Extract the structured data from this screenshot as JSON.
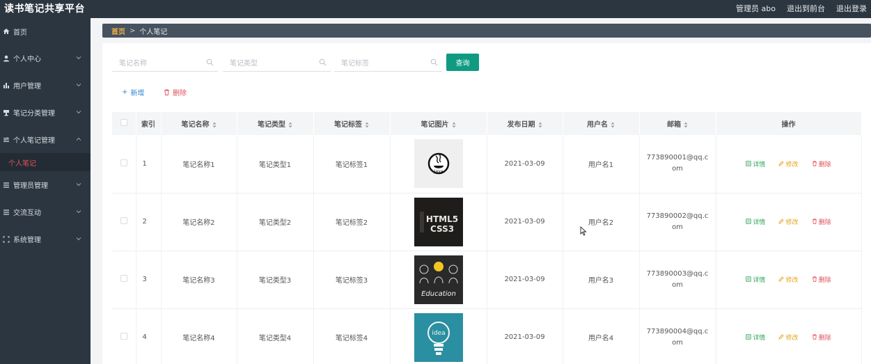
{
  "app": {
    "title": "读书笔记共享平台",
    "admin": "管理员 abo",
    "to_front": "退出到前台",
    "logout": "退出登录"
  },
  "sidebar": {
    "items": [
      {
        "label": "首页",
        "icon": "home-icon",
        "has_chevron": false
      },
      {
        "label": "个人中心",
        "icon": "user-icon",
        "has_chevron": true
      },
      {
        "label": "用户管理",
        "icon": "bar-chart-icon",
        "has_chevron": true
      },
      {
        "label": "笔记分类管理",
        "icon": "trophy-icon",
        "has_chevron": true
      },
      {
        "label": "个人笔记管理",
        "icon": "sliders-icon",
        "has_chevron": true,
        "expanded": true
      },
      {
        "label": "管理员管理",
        "icon": "list-icon",
        "has_chevron": true
      },
      {
        "label": "交流互动",
        "icon": "list-icon",
        "has_chevron": true
      },
      {
        "label": "系统管理",
        "icon": "expand-icon",
        "has_chevron": true
      }
    ],
    "sub_item": "个人笔记",
    "active_color": "#e2505a"
  },
  "breadcrumb": {
    "home": "首页",
    "sep": ">",
    "current": "个人笔记"
  },
  "search": {
    "name_placeholder": "笔记名称",
    "type_placeholder": "笔记类型",
    "tag_placeholder": "笔记标签",
    "query_label": "查询",
    "accent": "#0f9b82"
  },
  "toolbar": {
    "add_label": "新增",
    "delete_label": "删除"
  },
  "table": {
    "headers": {
      "index": "索引",
      "name": "笔记名称",
      "type": "笔记类型",
      "tag": "笔记标签",
      "image": "笔记图片",
      "date": "发布日期",
      "user": "用户名",
      "email": "邮箱",
      "ops": "操作"
    },
    "rows": [
      {
        "index": "1",
        "name": "笔记名称1",
        "type": "笔记类型1",
        "tag": "笔记标签1",
        "image": "java-logo",
        "date": "2021-03-09",
        "user": "用户名1",
        "email": "773890001@qq.com"
      },
      {
        "index": "2",
        "name": "笔记名称2",
        "type": "笔记类型2",
        "tag": "笔记标签2",
        "image": "html5-css3",
        "date": "2021-03-09",
        "user": "用户名2",
        "email": "773890002@qq.com"
      },
      {
        "index": "3",
        "name": "笔记名称3",
        "type": "笔记类型3",
        "tag": "笔记标签3",
        "image": "education",
        "date": "2021-03-09",
        "user": "用户名3",
        "email": "773890003@qq.com"
      },
      {
        "index": "4",
        "name": "笔记名称4",
        "type": "笔记类型4",
        "tag": "笔记标签4",
        "image": "idea-bulb",
        "date": "2021-03-09",
        "user": "用户名4",
        "email": "773890004@qq.com"
      }
    ],
    "actions": {
      "detail": "详情",
      "edit": "修改",
      "remove": "删除"
    },
    "images": {
      "html5_line1": "HTML5",
      "html5_line2": "CSS3",
      "education_text": "Education",
      "idea_text": "idea"
    }
  }
}
